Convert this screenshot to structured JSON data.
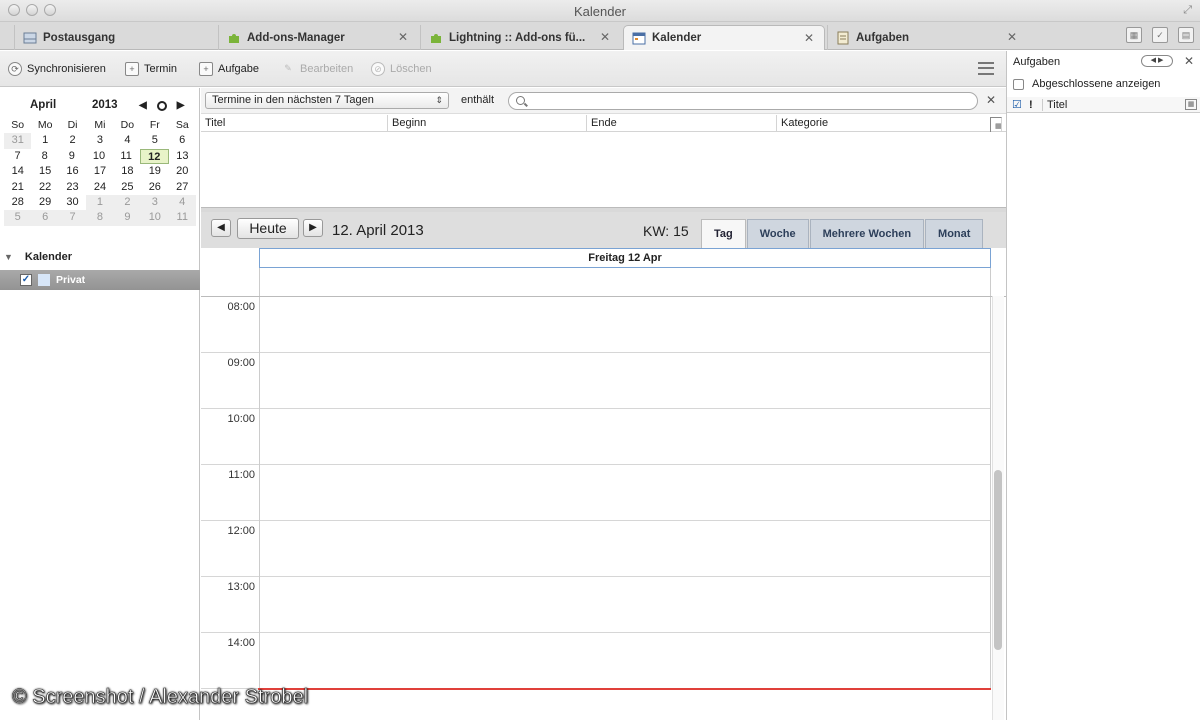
{
  "window": {
    "title": "Kalender"
  },
  "tabs": [
    {
      "label": "Postausgang",
      "icon": "outbox-icon",
      "closable": false
    },
    {
      "label": "Add-ons-Manager",
      "icon": "puzzle-icon",
      "closable": true
    },
    {
      "label": "Lightning :: Add-ons fü...",
      "icon": "puzzle-icon",
      "closable": true
    },
    {
      "label": "Kalender",
      "icon": "calendar-icon",
      "closable": true,
      "active": true
    },
    {
      "label": "Aufgaben",
      "icon": "tasks-icon",
      "closable": true
    }
  ],
  "toolbar": {
    "sync": "Synchronisieren",
    "event": "Termin",
    "task": "Aufgabe",
    "edit": "Bearbeiten",
    "delete": "Löschen"
  },
  "minical": {
    "month": "April",
    "year": "2013",
    "dow": [
      "So",
      "Mo",
      "Di",
      "Mi",
      "Do",
      "Fr",
      "Sa"
    ],
    "weeks": [
      [
        "31",
        "1",
        "2",
        "3",
        "4",
        "5",
        "6"
      ],
      [
        "7",
        "8",
        "9",
        "10",
        "11",
        "12",
        "13"
      ],
      [
        "14",
        "15",
        "16",
        "17",
        "18",
        "19",
        "20"
      ],
      [
        "21",
        "22",
        "23",
        "24",
        "25",
        "26",
        "27"
      ],
      [
        "28",
        "29",
        "30",
        "1",
        "2",
        "3",
        "4"
      ],
      [
        "5",
        "6",
        "7",
        "8",
        "9",
        "10",
        "11"
      ]
    ],
    "today": "12"
  },
  "calendars": {
    "header": "Kalender",
    "items": [
      {
        "name": "Privat",
        "checked": true
      }
    ]
  },
  "filter": {
    "range": "Termine in den nächsten 7 Tagen",
    "contains": "enthält",
    "search_placeholder": ""
  },
  "list": {
    "columns": [
      "Titel",
      "Beginn",
      "Ende",
      "Kategorie"
    ]
  },
  "dayview": {
    "today_button": "Heute",
    "date": "12. April 2013",
    "week": "KW: 15",
    "views": [
      "Tag",
      "Woche",
      "Mehrere Wochen",
      "Monat"
    ],
    "active_view": "Tag",
    "column": "Freitag 12 Apr",
    "hours": [
      "08:00",
      "09:00",
      "10:00",
      "11:00",
      "12:00",
      "13:00",
      "14:00"
    ]
  },
  "tasks": {
    "header": "Aufgaben",
    "show_completed": "Abgeschlossene anzeigen",
    "col_priority": "!",
    "col_title": "Titel"
  },
  "watermark": "© Screenshot / Alexander Strobel"
}
